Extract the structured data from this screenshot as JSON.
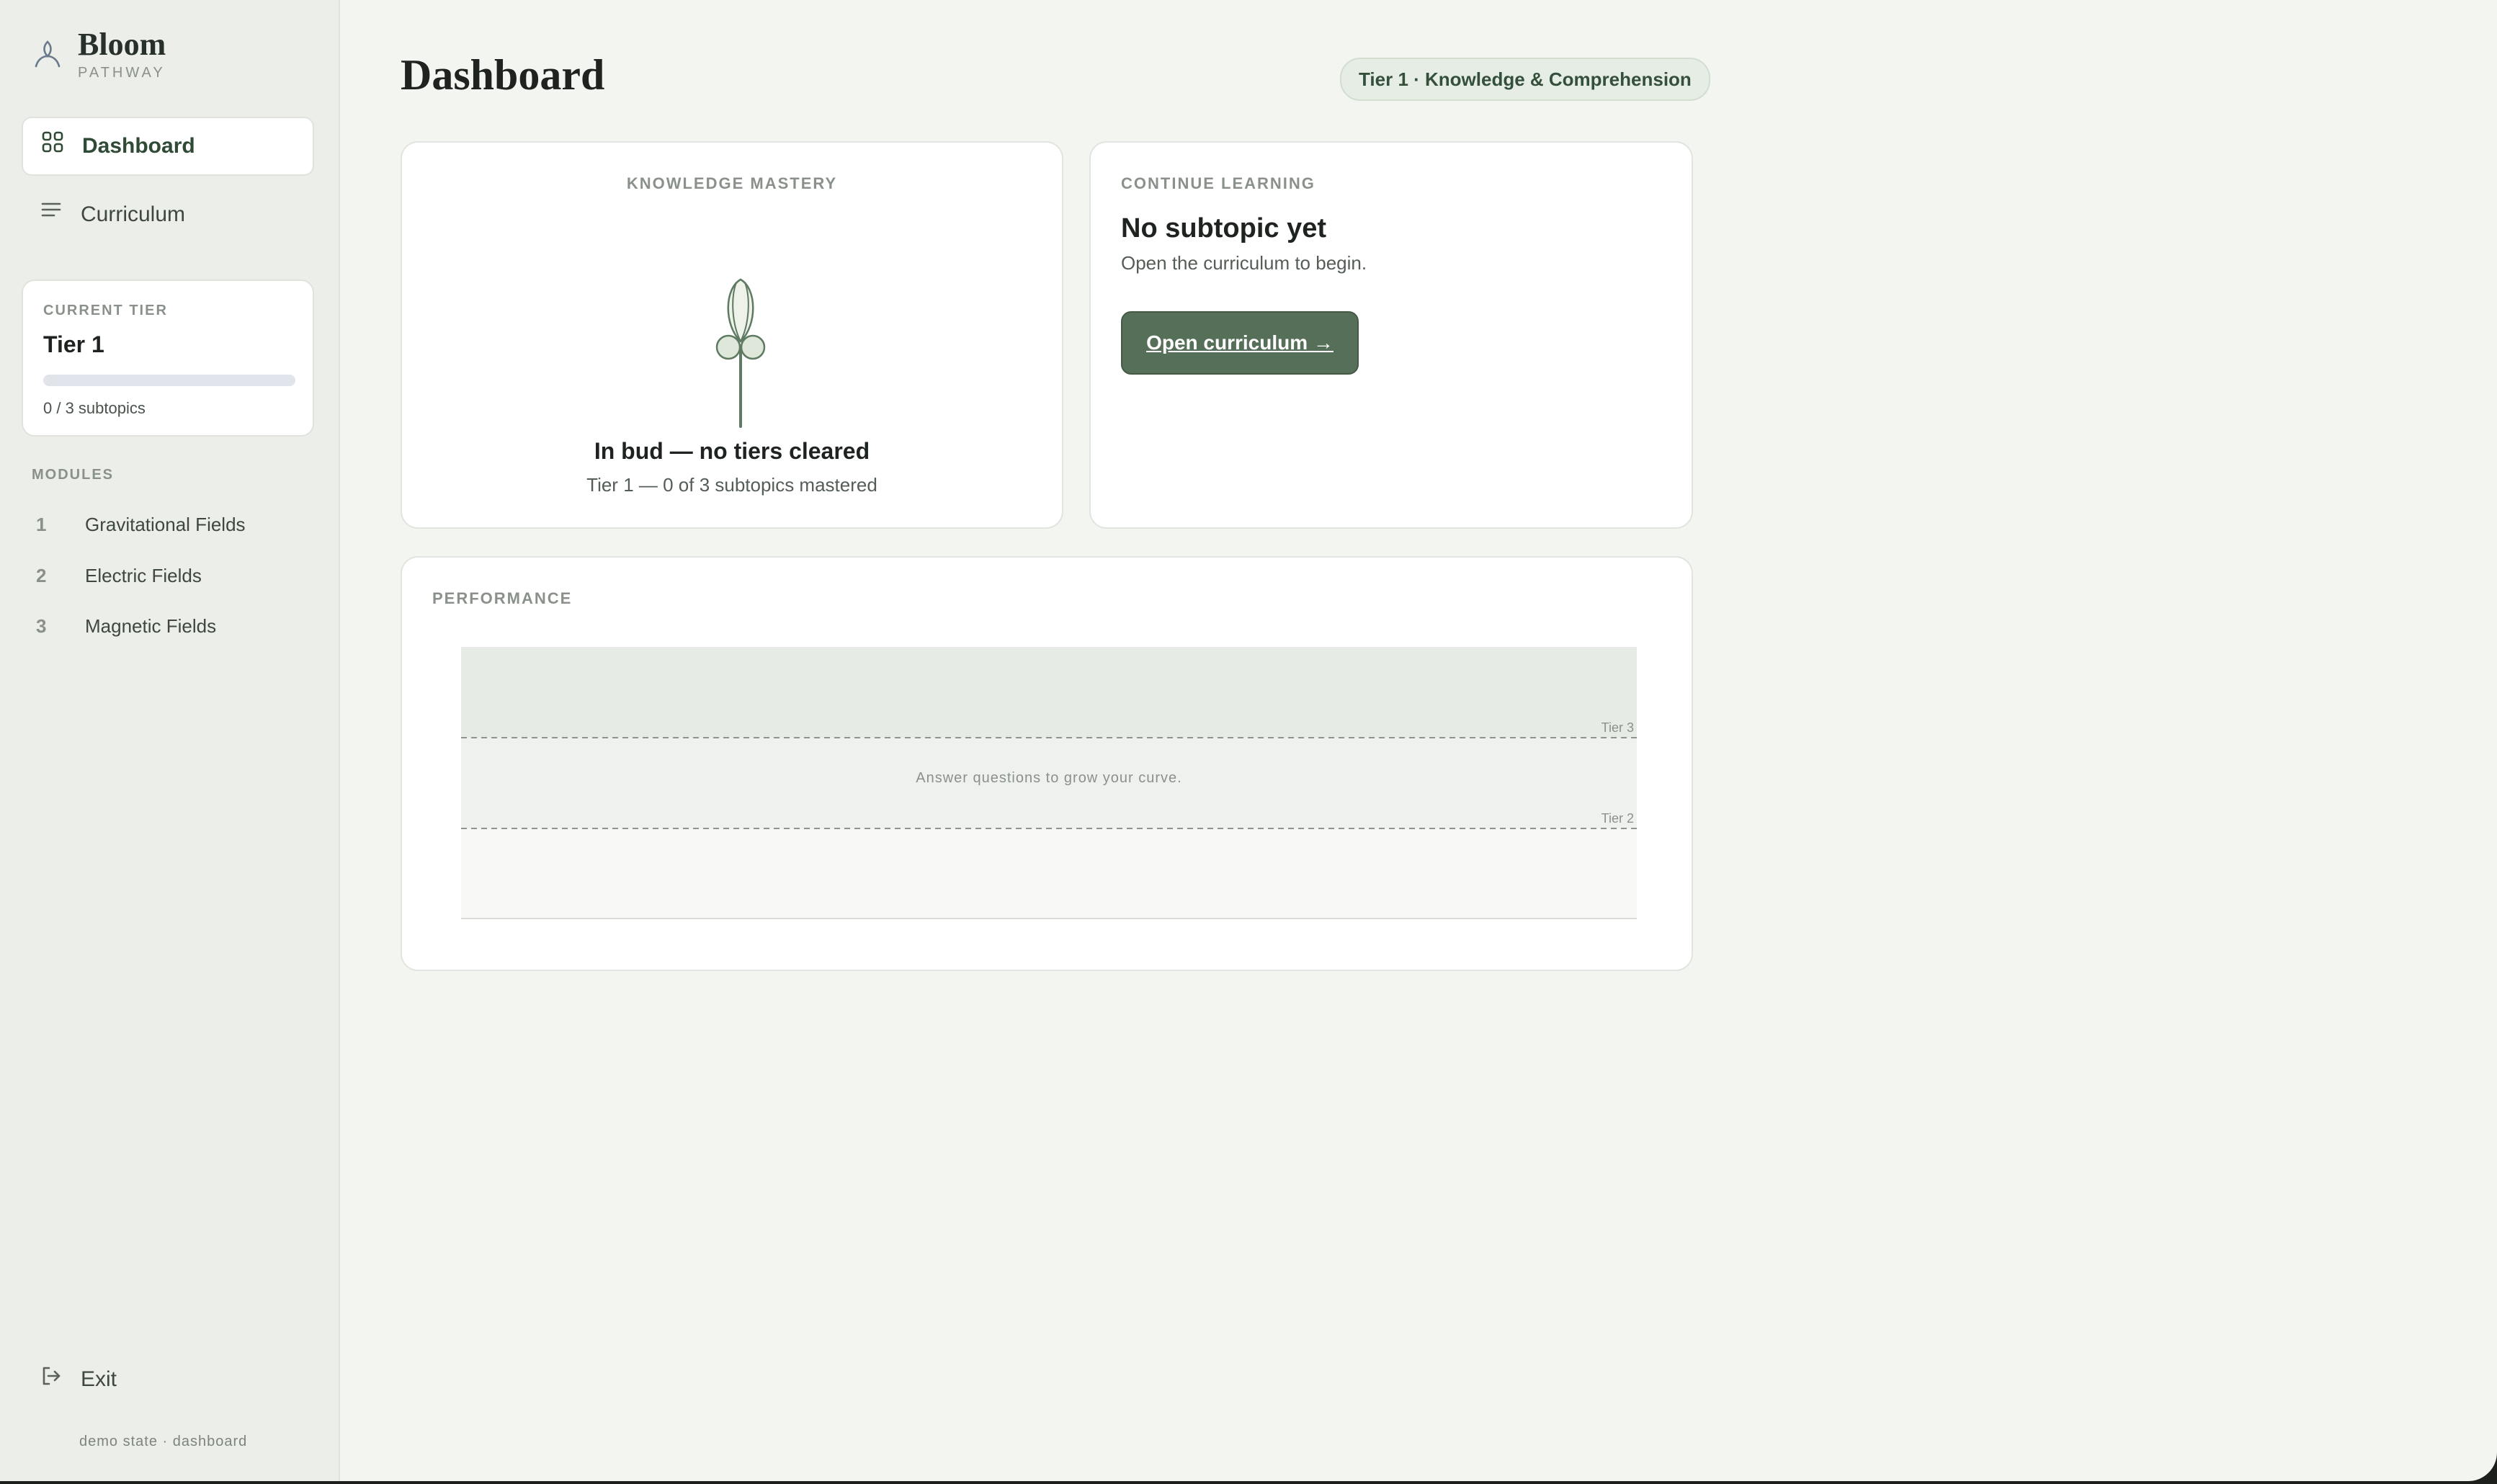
{
  "brand": {
    "name": "Bloom",
    "subtitle": "PATHWAY"
  },
  "nav": {
    "dashboard": "Dashboard",
    "curriculum": "Curriculum"
  },
  "tier_card": {
    "label": "CURRENT TIER",
    "value": "Tier 1",
    "progress": "0 / 3 subtopics",
    "progress_fraction": 0
  },
  "modules": {
    "label": "MODULES",
    "items": [
      {
        "num": "1",
        "name": "Gravitational Fields"
      },
      {
        "num": "2",
        "name": "Electric Fields"
      },
      {
        "num": "3",
        "name": "Magnetic Fields"
      }
    ]
  },
  "exit": "Exit",
  "footer_note": "demo state · dashboard",
  "header": {
    "title": "Dashboard",
    "tier_badge": "Tier 1 · Knowledge & Comprehension"
  },
  "mastery": {
    "label": "KNOWLEDGE MASTERY",
    "state": "In bud — no tiers cleared",
    "sub": "Tier 1 — 0 of 3 subtopics mastered"
  },
  "continue": {
    "label": "CONTINUE LEARNING",
    "heading": "No subtopic yet",
    "desc": "Open the curriculum to begin.",
    "button": "Open curriculum →"
  },
  "performance": {
    "label": "PERFORMANCE",
    "empty_message": "Answer questions to grow your curve.",
    "tier3": "Tier 3",
    "tier2": "Tier 2"
  },
  "colors": {
    "accent": "#566f59",
    "background": "#f3f5f1",
    "sidebar": "#ebeee9"
  }
}
